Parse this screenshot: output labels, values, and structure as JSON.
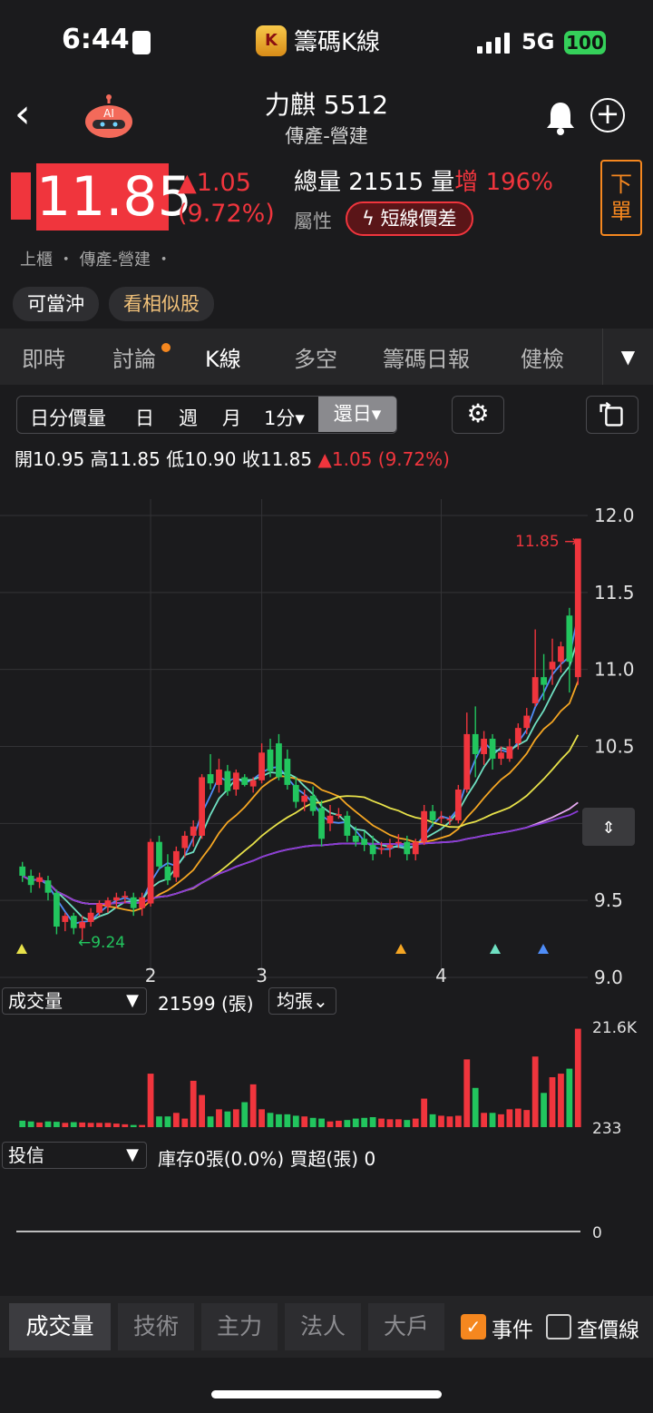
{
  "status_bar": {
    "time": "6:44",
    "app_name": "籌碼K線",
    "app_icon_letter": "K",
    "network": "5G",
    "battery": "100"
  },
  "header": {
    "stock_name": "力麒 5512",
    "sector": "傳產-營建",
    "ai_label": "AI"
  },
  "quote": {
    "price": "11.85",
    "change": "▲1.05",
    "change_pct": "(9.72%)",
    "volume_label": "總量",
    "volume": "21515",
    "volume_change_label": "量",
    "volume_change_word": "增",
    "volume_change_pct": "196%",
    "attribute_label": "屬性",
    "attribute_value": "短線價差",
    "order_button": "下單",
    "market_info": "上櫃 ・ 傳產-營建 ・"
  },
  "chips": [
    "可當沖",
    "看相似股"
  ],
  "tabs": [
    "即時",
    "討論",
    "K線",
    "多空",
    "籌碼日報",
    "健檢"
  ],
  "active_tab": "K線",
  "periods": {
    "items": [
      "日分價量",
      "日",
      "週",
      "月",
      "1分▾"
    ],
    "selected": "還日▾"
  },
  "ohlc": {
    "open_label": "開",
    "open": "10.95",
    "high_label": "高",
    "high": "11.85",
    "low_label": "低",
    "low": "10.90",
    "close_label": "收",
    "close": "11.85",
    "change": "▲1.05 (9.72%)"
  },
  "chart_data": {
    "type": "candlestick",
    "x_labels": [
      {
        "label": "2",
        "index": 15
      },
      {
        "label": "3",
        "index": 28
      },
      {
        "label": "4",
        "index": 49
      }
    ],
    "y_ticks": [
      "12.0",
      "11.5",
      "11.0",
      "10.5",
      "10.0",
      "9.5",
      "9.0"
    ],
    "ylim": [
      9.0,
      12.0
    ],
    "last_price_label": "11.85",
    "low_marker_label": "←9.24",
    "ohlc": [
      [
        9.72,
        9.75,
        9.62,
        9.66
      ],
      [
        9.66,
        9.7,
        9.55,
        9.6
      ],
      [
        9.62,
        9.68,
        9.58,
        9.65
      ],
      [
        9.63,
        9.66,
        9.5,
        9.55
      ],
      [
        9.55,
        9.57,
        9.28,
        9.33
      ],
      [
        9.36,
        9.42,
        9.3,
        9.4
      ],
      [
        9.4,
        9.42,
        9.28,
        9.32
      ],
      [
        9.32,
        9.4,
        9.24,
        9.36
      ],
      [
        9.36,
        9.45,
        9.33,
        9.42
      ],
      [
        9.42,
        9.5,
        9.4,
        9.48
      ],
      [
        9.46,
        9.52,
        9.42,
        9.5
      ],
      [
        9.5,
        9.55,
        9.45,
        9.52
      ],
      [
        9.52,
        9.56,
        9.48,
        9.53
      ],
      [
        9.52,
        9.55,
        9.4,
        9.45
      ],
      [
        9.45,
        9.55,
        9.4,
        9.52
      ],
      [
        9.48,
        9.9,
        9.46,
        9.88
      ],
      [
        9.88,
        9.92,
        9.7,
        9.72
      ],
      [
        9.72,
        9.8,
        9.6,
        9.63
      ],
      [
        9.65,
        9.85,
        9.62,
        9.82
      ],
      [
        9.84,
        9.95,
        9.78,
        9.92
      ],
      [
        9.92,
        10.02,
        9.85,
        9.98
      ],
      [
        9.92,
        10.32,
        9.9,
        10.3
      ],
      [
        10.32,
        10.45,
        10.22,
        10.26
      ],
      [
        10.25,
        10.42,
        10.2,
        10.35
      ],
      [
        10.34,
        10.38,
        10.18,
        10.21
      ],
      [
        10.22,
        10.35,
        10.18,
        10.33
      ],
      [
        10.3,
        10.32,
        10.24,
        10.25
      ],
      [
        10.24,
        10.3,
        10.2,
        10.28
      ],
      [
        10.28,
        10.52,
        10.26,
        10.46
      ],
      [
        10.48,
        10.55,
        10.3,
        10.34
      ],
      [
        10.52,
        10.58,
        10.28,
        10.3
      ],
      [
        10.42,
        10.48,
        10.22,
        10.25
      ],
      [
        10.25,
        10.3,
        10.1,
        10.14
      ],
      [
        10.14,
        10.22,
        10.08,
        10.18
      ],
      [
        10.18,
        10.24,
        10.05,
        10.08
      ],
      [
        10.1,
        10.15,
        9.85,
        9.9
      ],
      [
        10.0,
        10.12,
        9.95,
        10.05
      ],
      [
        10.05,
        10.1,
        10.03,
        10.06
      ],
      [
        10.05,
        10.08,
        9.88,
        9.92
      ],
      [
        9.92,
        9.98,
        9.85,
        9.88
      ],
      [
        9.9,
        9.95,
        9.82,
        9.86
      ],
      [
        9.86,
        9.92,
        9.76,
        9.8
      ],
      [
        9.83,
        9.88,
        9.8,
        9.84
      ],
      [
        9.84,
        9.9,
        9.78,
        9.86
      ],
      [
        9.88,
        9.93,
        9.84,
        9.88
      ],
      [
        9.88,
        9.92,
        9.76,
        9.8
      ],
      [
        9.8,
        9.9,
        9.76,
        9.88
      ],
      [
        9.88,
        10.12,
        9.86,
        10.08
      ],
      [
        10.08,
        10.12,
        9.98,
        10.02
      ],
      [
        10.04,
        10.08,
        10.0,
        10.04
      ],
      [
        10.02,
        10.05,
        9.99,
        10.03
      ],
      [
        10.02,
        10.25,
        10.0,
        10.22
      ],
      [
        10.22,
        10.72,
        10.2,
        10.58
      ],
      [
        10.58,
        10.76,
        10.3,
        10.45
      ],
      [
        10.45,
        10.6,
        10.38,
        10.55
      ],
      [
        10.55,
        10.58,
        10.35,
        10.42
      ],
      [
        10.42,
        10.5,
        10.38,
        10.46
      ],
      [
        10.42,
        10.55,
        10.4,
        10.5
      ],
      [
        10.52,
        10.65,
        10.48,
        10.62
      ],
      [
        10.62,
        10.75,
        10.58,
        10.7
      ],
      [
        10.78,
        11.26,
        10.76,
        10.95
      ],
      [
        10.95,
        11.1,
        10.8,
        10.9
      ],
      [
        11.0,
        11.2,
        10.9,
        11.05
      ],
      [
        11.05,
        11.18,
        10.98,
        11.15
      ],
      [
        11.35,
        11.4,
        10.85,
        11.05
      ],
      [
        10.95,
        11.85,
        10.9,
        11.85
      ]
    ]
  },
  "volume_panel": {
    "selector": "成交量",
    "value": "21599 (張)",
    "avg_button": "均張⌄",
    "ymax_label": "21.6K",
    "ymin_label": "233",
    "chart_data": {
      "type": "bar",
      "values": [
        900,
        800,
        650,
        800,
        750,
        600,
        700,
        650,
        600,
        600,
        600,
        500,
        400,
        300,
        300,
        7500,
        1500,
        1500,
        2000,
        1200,
        6500,
        4500,
        1500,
        2500,
        2200,
        2500,
        3500,
        6000,
        2500,
        2000,
        1800,
        1800,
        1600,
        1500,
        1300,
        1200,
        800,
        900,
        1000,
        1200,
        1300,
        1400,
        1200,
        1100,
        1100,
        1000,
        1200,
        4000,
        1800,
        1600,
        1500,
        1600,
        9500,
        5500,
        2000,
        2000,
        1800,
        2500,
        2600,
        2400,
        9900,
        4800,
        7000,
        7500,
        8200,
        13800
      ],
      "ylim": [
        0,
        14000
      ]
    }
  },
  "investment_panel": {
    "selector": "投信",
    "text": "庫存0張(0.0%)  買超(張) 0",
    "zero_label": "0"
  },
  "bottom_tabs": [
    "成交量",
    "技術",
    "主力",
    "法人",
    "大戶"
  ],
  "active_bottom_tab": "成交量",
  "toggles": [
    {
      "label": "事件",
      "checked": true
    },
    {
      "label": "查價線",
      "checked": false
    }
  ],
  "colors": {
    "up": "#f0353d",
    "down": "#22c55e",
    "accent": "#f5871f"
  }
}
